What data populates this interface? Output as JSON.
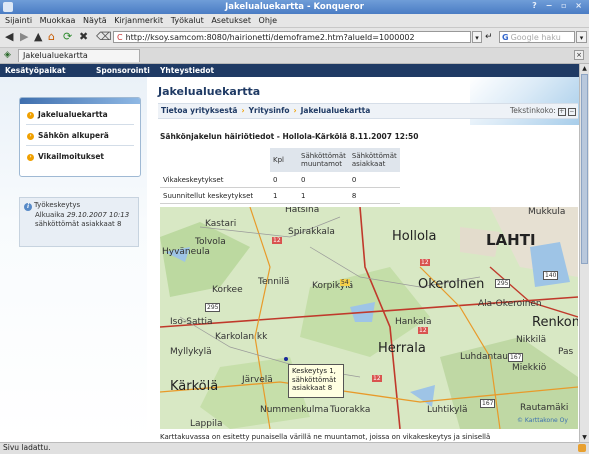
{
  "window": {
    "title": "Jakelualuekartta - Konqueror"
  },
  "menu": [
    "Sijainti",
    "Muokkaa",
    "Näytä",
    "Kirjanmerkit",
    "Työkalut",
    "Asetukset",
    "Ohje"
  ],
  "toolbar": {
    "url": "http://ksoy.samcom:8080/hairionetti/demoframe2.htm?alueId=1000002",
    "search_placeholder": "Google haku"
  },
  "tab": {
    "label": "Jakelualuekartta"
  },
  "site_nav": [
    "Kesätyöpaikat",
    "Sponsorointi",
    "Yhteystiedot"
  ],
  "sidebar": {
    "items": [
      {
        "label": "Jakelualuekartta"
      },
      {
        "label": "Sähkön alkuperä"
      },
      {
        "label": "Vikailmoitukset"
      }
    ],
    "info": {
      "title": "Työkeskeytys",
      "line1_prefix": "Alkuaika",
      "line1_time": "29.10.2007 10:13",
      "line2": "sähköttömät asiakkaat 8"
    }
  },
  "page_title": "Jakelualuekartta",
  "breadcrumb": [
    "Tietoa yrityksestä",
    "Yritysinfo",
    "Jakelualuekartta"
  ],
  "text_size_label": "Tekstinkoko:",
  "status_title": "Sähkönjakelun häiriötiedot - Hollola-Kärkölä 8.11.2007 12:50",
  "table": {
    "headers": [
      "",
      "Kpl",
      "Sähköttömät muuntamot",
      "Sähköttömät asiakkaat"
    ],
    "rows": [
      [
        "Vikakeskeytykset",
        "0",
        "0",
        "0"
      ],
      [
        "Suunnitellut keskeytykset",
        "1",
        "1",
        "8"
      ]
    ]
  },
  "map": {
    "labels": [
      "Hatsina",
      "Mukkula",
      "Kastari",
      "Spirakkala",
      "Tolvola",
      "Hollola",
      "LAHTI",
      "Hyväneula",
      "Tennilä",
      "Korpikylä",
      "Okerolnen",
      "Korkee",
      "Ala-Okeroinen",
      "Iso-Sattia",
      "Hankala",
      "Renkom",
      "Karkolan kk",
      "Herrala",
      "Nikkilä",
      "Pas",
      "Myllykylä",
      "Luhdantausta",
      "Miekkiö",
      "Järvelä",
      "Kärkölä",
      "Rautamäki",
      "Nummenkulma",
      "Tuorakka",
      "Luhtikylä",
      "Lappila"
    ],
    "road_numbers": [
      "12",
      "12",
      "140",
      "295",
      "54",
      "12",
      "167",
      "295",
      "12",
      "167"
    ],
    "tooltip": [
      "Keskeytys 1,",
      "sähköttömät",
      "asiakkaat 8"
    ],
    "copyright": "© Karttakone Oy"
  },
  "bottom_text": "Karttakuvassa on esitetty punaisella värillä ne muuntamot, joissa on vikakeskeytys ja sinisellä",
  "status_bar": "Sivu ladattu.",
  "colors": {
    "nav": "#1f3a64",
    "accent": "#f0a000",
    "title_bar": "#4a7cc4"
  }
}
